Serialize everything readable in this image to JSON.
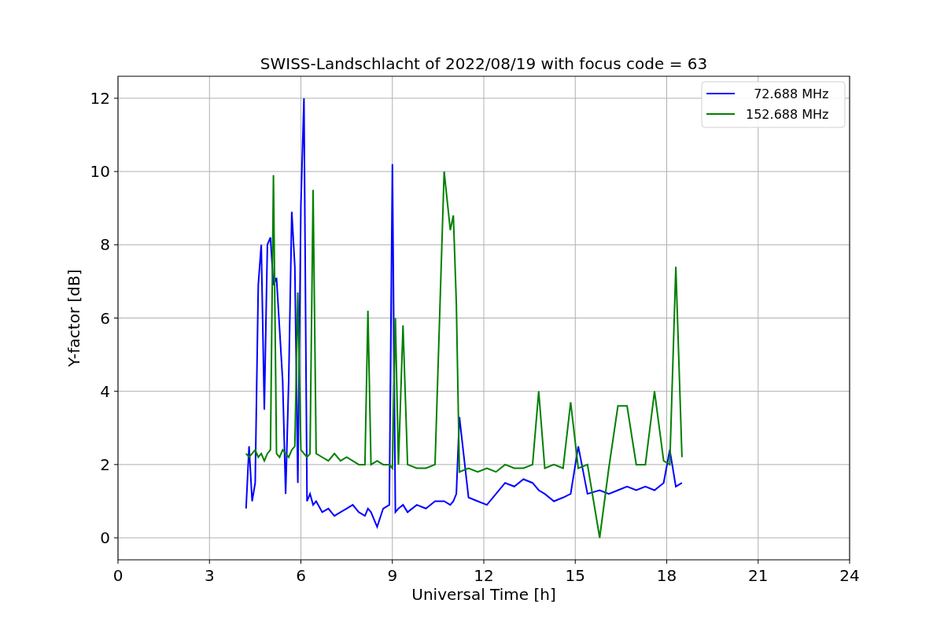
{
  "chart_data": {
    "type": "line",
    "title": "SWISS-Landschlacht of 2022/08/19 with focus code = 63",
    "xlabel": "Universal Time [h]",
    "ylabel": "Y-factor [dB]",
    "xlim": [
      0,
      24
    ],
    "ylim": [
      -0.6,
      12.6
    ],
    "grid": true,
    "legend": true,
    "xticks": [
      0,
      3,
      6,
      9,
      12,
      15,
      18,
      21,
      24
    ],
    "yticks": [
      0,
      2,
      4,
      6,
      8,
      10,
      12
    ],
    "x": [
      4.2,
      4.3,
      4.4,
      4.5,
      4.6,
      4.7,
      4.8,
      4.9,
      5.0,
      5.1,
      5.2,
      5.3,
      5.4,
      5.5,
      5.6,
      5.7,
      5.8,
      5.9,
      6.0,
      6.1,
      6.2,
      6.3,
      6.4,
      6.5,
      6.7,
      6.9,
      7.1,
      7.3,
      7.5,
      7.7,
      7.9,
      8.1,
      8.2,
      8.3,
      8.5,
      8.7,
      8.9,
      9.0,
      9.1,
      9.2,
      9.35,
      9.5,
      9.8,
      10.1,
      10.4,
      10.7,
      10.9,
      11.0,
      11.1,
      11.2,
      11.5,
      11.8,
      12.1,
      12.4,
      12.7,
      13.0,
      13.3,
      13.6,
      13.8,
      14.0,
      14.3,
      14.6,
      14.85,
      15.1,
      15.4,
      15.8,
      16.1,
      16.4,
      16.7,
      17.0,
      17.3,
      17.6,
      17.9,
      18.1,
      18.3,
      18.5
    ],
    "series": [
      {
        "name": "  72.688 MHz",
        "color": "#0000ff",
        "values": [
          0.8,
          2.5,
          1.0,
          1.5,
          6.9,
          8.0,
          3.5,
          8.0,
          8.2,
          6.9,
          7.1,
          5.7,
          4.3,
          1.2,
          4.3,
          8.9,
          7.4,
          1.5,
          9.1,
          12.0,
          1.0,
          1.2,
          0.9,
          1.0,
          0.7,
          0.8,
          0.6,
          0.7,
          0.8,
          0.9,
          0.7,
          0.6,
          0.8,
          0.7,
          0.3,
          0.8,
          0.9,
          10.2,
          0.7,
          0.8,
          0.9,
          0.7,
          0.9,
          0.8,
          1.0,
          1.0,
          0.9,
          1.0,
          1.2,
          3.3,
          1.1,
          1.0,
          0.9,
          1.2,
          1.5,
          1.4,
          1.6,
          1.5,
          1.3,
          1.2,
          1.0,
          1.1,
          1.2,
          2.5,
          1.2,
          1.3,
          1.2,
          1.3,
          1.4,
          1.3,
          1.4,
          1.3,
          1.5,
          2.4,
          1.4,
          1.5
        ]
      },
      {
        "name": "152.688 MHz",
        "color": "#008000",
        "values": [
          2.3,
          2.2,
          2.3,
          2.4,
          2.2,
          2.3,
          2.1,
          2.3,
          2.4,
          9.9,
          2.3,
          2.2,
          2.4,
          2.3,
          2.2,
          2.4,
          2.5,
          6.7,
          2.4,
          2.3,
          2.2,
          2.3,
          9.5,
          2.3,
          2.2,
          2.1,
          2.3,
          2.1,
          2.2,
          2.1,
          2.0,
          2.0,
          6.2,
          2.0,
          2.1,
          2.0,
          2.0,
          1.9,
          6.0,
          2.0,
          5.8,
          2.0,
          1.9,
          1.9,
          2.0,
          10.0,
          8.4,
          8.8,
          6.4,
          1.8,
          1.9,
          1.8,
          1.9,
          1.8,
          2.0,
          1.9,
          1.9,
          2.0,
          4.0,
          1.9,
          2.0,
          1.9,
          3.7,
          1.9,
          2.0,
          0.0,
          1.9,
          3.6,
          3.6,
          2.0,
          2.0,
          4.0,
          2.1,
          2.0,
          7.4,
          2.2
        ]
      }
    ]
  }
}
